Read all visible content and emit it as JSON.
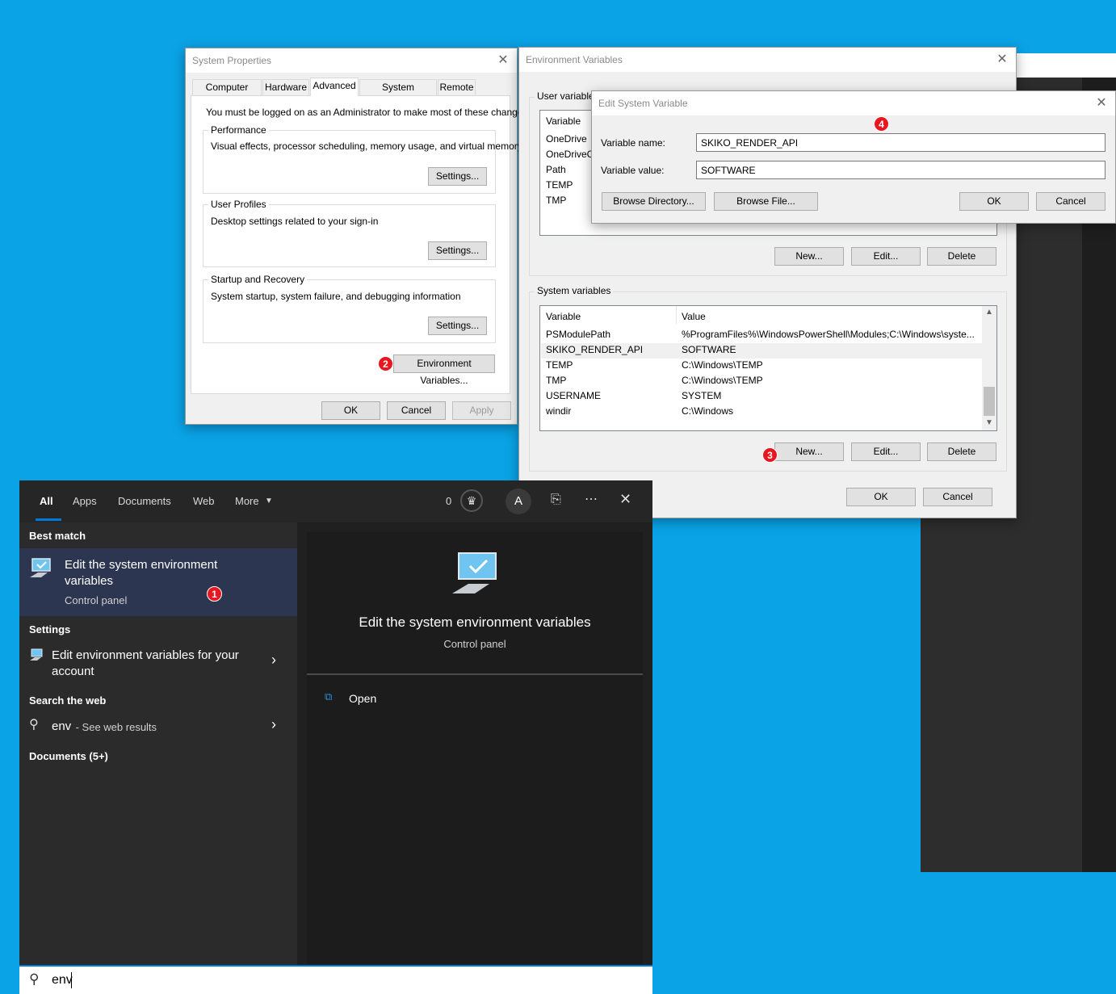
{
  "system_properties": {
    "title": "System Properties",
    "tabs": [
      "Computer Name",
      "Hardware",
      "Advanced",
      "System Protection",
      "Remote"
    ],
    "admin_note": "You must be logged on as an Administrator to make most of these changes.",
    "performance": {
      "title": "Performance",
      "desc": "Visual effects, processor scheduling, memory usage, and virtual memory",
      "button": "Settings..."
    },
    "user_profiles": {
      "title": "User Profiles",
      "desc": "Desktop settings related to your sign-in",
      "button": "Settings..."
    },
    "startup": {
      "title": "Startup and Recovery",
      "desc": "System startup, system failure, and debugging information",
      "button": "Settings..."
    },
    "env_button": "Environment Variables...",
    "ok": "OK",
    "cancel": "Cancel",
    "apply": "Apply"
  },
  "env_vars": {
    "title": "Environment Variables",
    "user_group": "User variable",
    "user_header": "Variable",
    "user_rows": [
      "OneDrive",
      "OneDriveC",
      "Path",
      "TEMP",
      "TMP"
    ],
    "user_buttons": {
      "new": "New...",
      "edit": "Edit...",
      "delete": "Delete"
    },
    "system_group": "System variables",
    "system_headers": {
      "variable": "Variable",
      "value": "Value"
    },
    "system_rows": [
      {
        "name": "PSModulePath",
        "value": "%ProgramFiles%\\WindowsPowerShell\\Modules;C:\\Windows\\syste..."
      },
      {
        "name": "SKIKO_RENDER_API",
        "value": "SOFTWARE"
      },
      {
        "name": "TEMP",
        "value": "C:\\Windows\\TEMP"
      },
      {
        "name": "TMP",
        "value": "C:\\Windows\\TEMP"
      },
      {
        "name": "USERNAME",
        "value": "SYSTEM"
      },
      {
        "name": "windir",
        "value": "C:\\Windows"
      }
    ],
    "system_buttons": {
      "new": "New...",
      "edit": "Edit...",
      "delete": "Delete"
    },
    "ok": "OK",
    "cancel": "Cancel"
  },
  "edit_var": {
    "title": "Edit System Variable",
    "name_label": "Variable name:",
    "name_value": "SKIKO_RENDER_API",
    "value_label": "Variable value:",
    "value_value": "SOFTWARE",
    "browse_dir": "Browse Directory...",
    "browse_file": "Browse File...",
    "ok": "OK",
    "cancel": "Cancel"
  },
  "badges": [
    "1",
    "2",
    "3",
    "4"
  ],
  "start_menu": {
    "tabs": [
      "All",
      "Apps",
      "Documents",
      "Web",
      "More"
    ],
    "points": "0",
    "avatar": "A",
    "best_match_label": "Best match",
    "best_match": {
      "title_line1": "Edit the system environment",
      "title_line2": "variables",
      "subtitle": "Control panel"
    },
    "settings_label": "Settings",
    "settings_item": {
      "line1": "Edit environment variables for your",
      "line2": "account"
    },
    "web_label": "Search the web",
    "web_item": {
      "query": "env",
      "suffix": " - See web results"
    },
    "documents_label": "Documents (5+)",
    "preview": {
      "title": "Edit the system environment variables",
      "subtitle": "Control panel",
      "open": "Open"
    },
    "search_value": "env"
  },
  "icons": [
    "monitor-check-icon",
    "search-icon",
    "trophy-icon",
    "feedback-icon",
    "more-icon",
    "close-icon",
    "chevron-right-icon",
    "open-icon",
    "caret-down-icon"
  ]
}
